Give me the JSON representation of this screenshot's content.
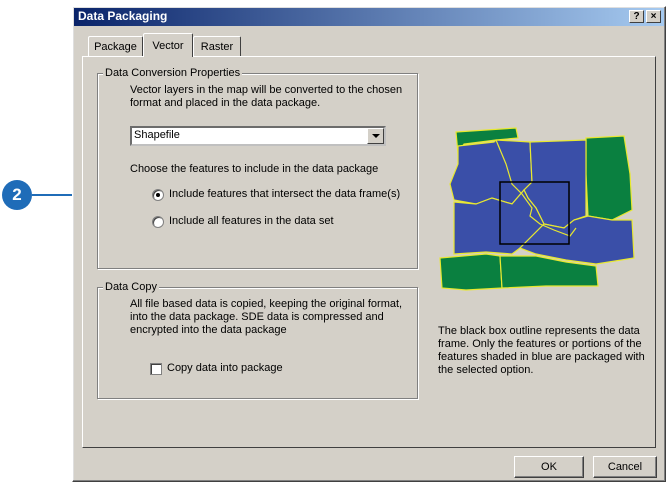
{
  "callout": {
    "number": "2"
  },
  "window": {
    "title": "Data Packaging",
    "help_glyph": "?",
    "close_glyph": "×"
  },
  "tabs": [
    {
      "label": "Package"
    },
    {
      "label": "Vector"
    },
    {
      "label": "Raster"
    }
  ],
  "conversion": {
    "group_label": "Data Conversion Properties",
    "description": "Vector layers in the map will be converted to the chosen format and placed in the data package.",
    "format_value": "Shapefile",
    "choose_label": "Choose the features to include in the data package",
    "options": [
      {
        "label": "Include features that intersect the data frame(s)",
        "selected": true
      },
      {
        "label": "Include all features in the data set",
        "selected": false
      }
    ]
  },
  "copy": {
    "group_label": "Data Copy",
    "description": "All file based data is copied, keeping the original format, into the data package.   SDE data is compressed and encrypted into the data package",
    "checkbox_label": "Copy data into package",
    "checked": false
  },
  "map": {
    "caption": "The black box outline represents the data frame.  Only the features or portions of the features shaded in blue are packaged with the selected option.",
    "colors": {
      "blue": "#3a4fa8",
      "green": "#0a8040",
      "outline": "#e8e830",
      "frame": "#000000"
    }
  },
  "buttons": {
    "ok": "OK",
    "cancel": "Cancel"
  }
}
